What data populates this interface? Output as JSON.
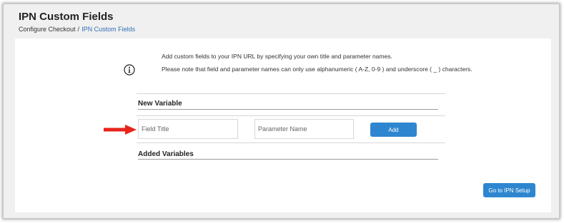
{
  "header": {
    "title": "IPN Custom Fields",
    "breadcrumb": [
      {
        "label": "Configure Checkout"
      },
      {
        "label": "IPN Custom Fields"
      }
    ],
    "breadcrumb_separator": "/"
  },
  "info": {
    "icon": "info-circle-icon",
    "line1": "Add custom fields to your IPN URL by specifying your own title and parameter names.",
    "line2": "Please note that field and parameter names can only use alphanumeric ( A-Z, 0-9 ) and underscore ( _ ) characters."
  },
  "new_variable": {
    "heading": "New Variable",
    "field_title_placeholder": "Field Title",
    "field_title_value": "",
    "parameter_name_placeholder": "Parameter Name",
    "parameter_name_value": "",
    "add_label": "Add"
  },
  "added_variables": {
    "heading": "Added Variables"
  },
  "footer": {
    "ipn_setup_label": "Go to IPN Setup"
  },
  "colors": {
    "accent": "#2d86cf",
    "link": "#2f6fb5",
    "arrow": "#e8231a"
  }
}
